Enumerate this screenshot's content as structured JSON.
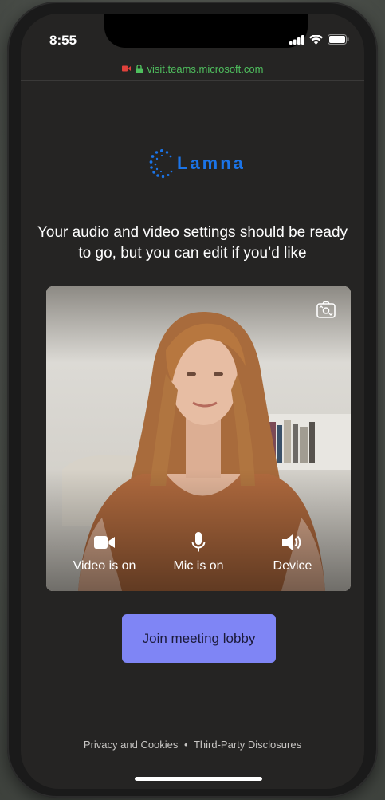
{
  "status_bar": {
    "time": "8:55",
    "icons": [
      "signal-icon",
      "wifi-icon",
      "battery-icon"
    ]
  },
  "browser": {
    "url": "visit.teams.microsoft.com",
    "icons": [
      "camera-recording-icon",
      "lock-icon"
    ]
  },
  "brand": {
    "name": "Lamna",
    "color": "#1b74e8"
  },
  "headline": "Your audio and video settings should be ready to go, but you can edit if you’d like",
  "preview": {
    "controls": [
      {
        "label": "Video is on",
        "icon": "video-camera-icon"
      },
      {
        "label": "Mic is on",
        "icon": "microphone-icon"
      },
      {
        "label": "Device",
        "icon": "speaker-icon"
      }
    ],
    "switch_camera_icon": "switch-camera-icon"
  },
  "join_button": {
    "label": "Join meeting lobby",
    "color": "#7f85f5"
  },
  "footer": {
    "privacy": "Privacy and Cookies",
    "separator": "•",
    "disclosures": "Third-Party Disclosures"
  }
}
